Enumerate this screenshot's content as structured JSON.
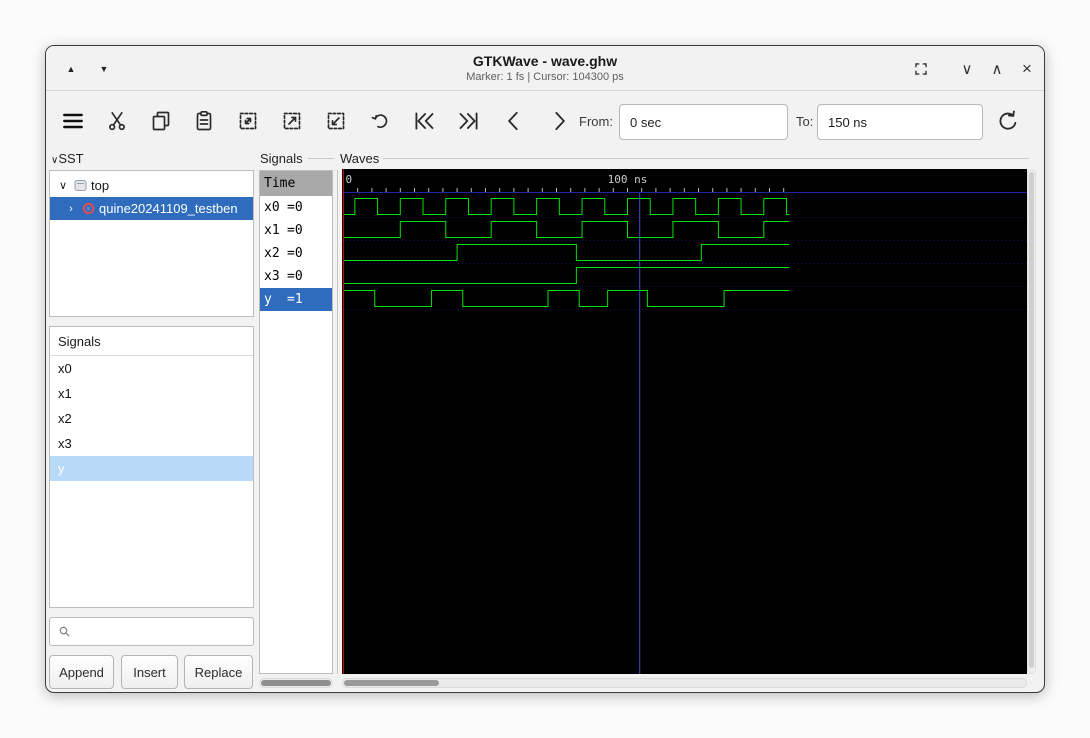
{
  "window": {
    "title": "GTKWave - wave.ghw",
    "statusline": "Marker: 1 fs | Cursor: 104300 ps"
  },
  "toolbar": {
    "from_label": "From:",
    "from_value": "0 sec",
    "to_label": "To:",
    "to_value": "150 ns"
  },
  "sst": {
    "header": "SST",
    "nodes": [
      {
        "label": "top"
      },
      {
        "label": "quine20241109_testben"
      }
    ]
  },
  "search": {
    "placeholder": ""
  },
  "signal_list": {
    "header": "Signals",
    "items": [
      "x0",
      "x1",
      "x2",
      "x3",
      "y"
    ],
    "buttons": {
      "append": "Append",
      "insert": "Insert",
      "replace": "Replace"
    }
  },
  "signals_pane": {
    "frame_label": "Signals",
    "time_header": "Time",
    "rows": [
      {
        "name": "x0",
        "value": "=0"
      },
      {
        "name": "x1",
        "value": "=0"
      },
      {
        "name": "x2",
        "value": "=0"
      },
      {
        "name": "x3",
        "value": "=0"
      },
      {
        "name": "y",
        "value": "=1"
      }
    ]
  },
  "waves_pane": {
    "frame_label": "Waves",
    "colors": {
      "wave": "#00e10a",
      "marker": "#d40000",
      "cursor": "#4a4ac8",
      "grid": "#2323a8",
      "ruler_text": "#cccccc",
      "bg": "#000000"
    }
  },
  "chart_data": {
    "type": "digital-waveform",
    "time_unit": "ns",
    "t_start": 0,
    "t_end": 157,
    "visible_from": "0 sec",
    "visible_to": "150 ns",
    "marker_ns": 1e-06,
    "cursor_ns": 104.3,
    "ruler_labels": [
      {
        "t": 0,
        "text": "0"
      },
      {
        "t": 100,
        "text": "100 ns"
      }
    ],
    "signals": [
      {
        "name": "x0",
        "value_at_marker": 0,
        "high_intervals": [
          [
            4,
            12
          ],
          [
            20,
            28
          ],
          [
            36,
            44
          ],
          [
            52,
            60
          ],
          [
            68,
            76
          ],
          [
            84,
            92
          ],
          [
            100,
            108
          ],
          [
            116,
            124
          ],
          [
            132,
            140
          ],
          [
            148,
            156
          ]
        ]
      },
      {
        "name": "x1",
        "value_at_marker": 0,
        "high_intervals": [
          [
            20,
            36
          ],
          [
            52,
            68
          ],
          [
            84,
            100
          ],
          [
            116,
            132
          ],
          [
            148,
            157
          ]
        ]
      },
      {
        "name": "x2",
        "value_at_marker": 0,
        "high_intervals": [
          [
            40,
            82
          ],
          [
            126,
            157
          ]
        ]
      },
      {
        "name": "x3",
        "value_at_marker": 0,
        "high_intervals": [
          [
            82,
            157
          ]
        ]
      },
      {
        "name": "y",
        "value_at_marker": 1,
        "high_intervals": [
          [
            0,
            11
          ],
          [
            31,
            42
          ],
          [
            72,
            83
          ],
          [
            93,
            107
          ],
          [
            134,
            157
          ]
        ]
      }
    ]
  }
}
